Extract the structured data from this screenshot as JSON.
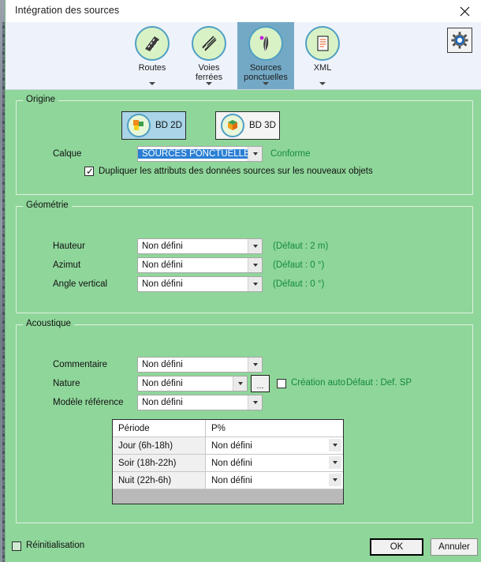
{
  "window": {
    "title": "Intégration des sources",
    "close_icon": "close-icon"
  },
  "ribbon": {
    "tabs": [
      {
        "label_line1": "Routes",
        "label_line2": "",
        "icon": "road-icon",
        "active": false,
        "has_caret": true
      },
      {
        "label_line1": "Voies",
        "label_line2": "ferrées",
        "icon": "railway-icon",
        "active": false,
        "has_caret": true
      },
      {
        "label_line1": "Sources",
        "label_line2": "ponctuelles",
        "icon": "point-source-icon",
        "active": true,
        "has_caret": true
      },
      {
        "label_line1": "XML",
        "label_line2": "",
        "icon": "xml-document-icon",
        "active": false,
        "has_caret": true
      }
    ],
    "settings_button": {
      "name": "gear-icon",
      "tooltip": ""
    }
  },
  "origine": {
    "title": "Origine",
    "buttons": [
      {
        "label": "BD 2D",
        "icon": "bd2d-icon",
        "selected": true
      },
      {
        "label": "BD 3D",
        "icon": "bd3d-icon",
        "selected": false
      }
    ],
    "calque": {
      "label": "Calque",
      "value": "SOURCES PONCTUELLES",
      "status": "Conforme"
    },
    "duplicate": {
      "label": "Dupliquer les attributs des données sources sur les nouveaux objets",
      "checked": true
    }
  },
  "geometrie": {
    "title": "Géométrie",
    "rows": [
      {
        "label": "Hauteur",
        "value": "Non défini",
        "hint": "(Défaut : 2 m)"
      },
      {
        "label": "Azimut",
        "value": "Non défini",
        "hint": "(Défaut : 0 °)"
      },
      {
        "label": "Angle vertical",
        "value": "Non défini",
        "hint": "(Défaut : 0 °)"
      }
    ]
  },
  "acoustique": {
    "title": "Acoustique",
    "rows": [
      {
        "label": "Commentaire",
        "value": "Non défini"
      },
      {
        "label": "Nature",
        "value": "Non défini"
      },
      {
        "label": "Modèle référence",
        "value": "Non défini"
      }
    ],
    "browse_button": "...",
    "creation_auto": {
      "label": "Création auto",
      "checked": false
    },
    "default_hint": "Défaut : Def. SP",
    "table": {
      "headers": [
        "Période",
        "P%"
      ],
      "rows": [
        {
          "period": "Jour (6h-18h)",
          "value": "Non défini"
        },
        {
          "period": "Soir (18h-22h)",
          "value": "Non défini"
        },
        {
          "period": "Nuit (22h-6h)",
          "value": "Non défini"
        }
      ]
    }
  },
  "footer": {
    "reset": {
      "label": "Réinitialisation",
      "checked": false
    },
    "ok_label": "OK",
    "cancel_label": "Annuler"
  },
  "colors": {
    "dialog_background": "#8fd69a",
    "ribbon_background": "#eef3fb",
    "active_tab": "#74a9c6",
    "hint_green": "#138a3c",
    "selection_blue": "#2a7fd4"
  }
}
